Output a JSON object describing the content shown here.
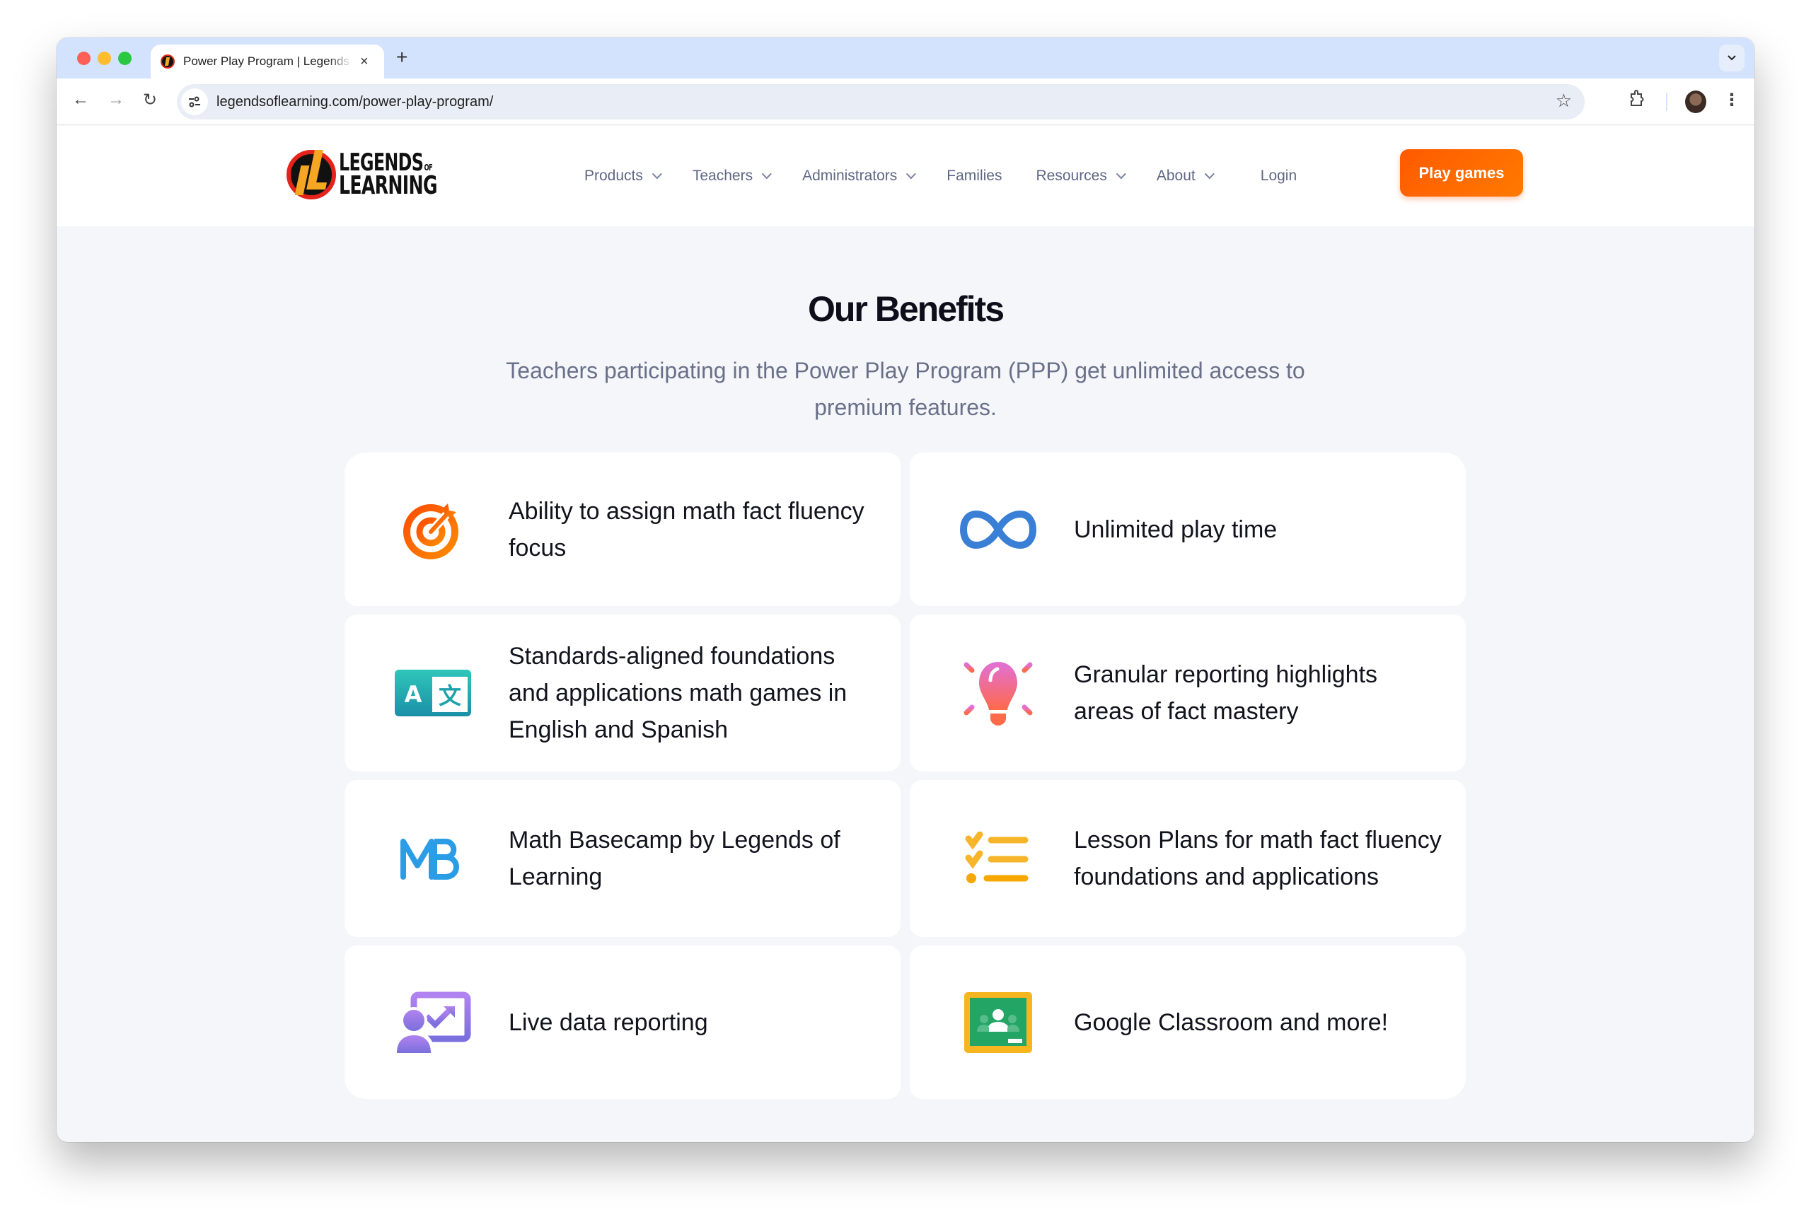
{
  "browser": {
    "tab_title": "Power Play Program | Legends of Learning",
    "url": "legendsoflearning.com/power-play-program/",
    "icons": {
      "close": "×",
      "new_tab": "+",
      "tab_menu": "⌄",
      "back": "←",
      "forward": "→",
      "reload": "↻",
      "site_info": "⚙",
      "bookmark": "☆",
      "extensions": "⧉",
      "menu": "⋮"
    }
  },
  "header": {
    "logo": {
      "line1": "LEGENDS",
      "of": "OF",
      "line2": "LEARNING"
    },
    "nav": [
      {
        "label": "Products",
        "dropdown": true
      },
      {
        "label": "Teachers",
        "dropdown": true
      },
      {
        "label": "Administrators",
        "dropdown": true
      },
      {
        "label": "Families",
        "dropdown": false
      },
      {
        "label": "Resources",
        "dropdown": true
      },
      {
        "label": "About",
        "dropdown": true
      }
    ],
    "login_label": "Login",
    "cta_label": "Play games",
    "cta_color": "#ff6a00"
  },
  "benefits": {
    "title": "Our Benefits",
    "subtitle": "Teachers participating in the Power Play Program (PPP) get unlimited access to premium features.",
    "items": [
      {
        "icon": "target-icon",
        "text": "Ability to assign math fact fluency focus"
      },
      {
        "icon": "infinity-icon",
        "text": "Unlimited play time"
      },
      {
        "icon": "translate-icon",
        "text": "Standards-aligned foundations and applications math games in English and Spanish"
      },
      {
        "icon": "lightbulb-icon",
        "text": "Granular reporting highlights areas of fact mastery"
      },
      {
        "icon": "math-basecamp-logo-icon",
        "text": "Math Basecamp by Legends of Learning",
        "icon_text": "MB"
      },
      {
        "icon": "checklist-icon",
        "text": "Lesson Plans for math fact fluency foundations and applications"
      },
      {
        "icon": "presentation-chart-icon",
        "text": "Live data reporting"
      },
      {
        "icon": "google-classroom-icon",
        "text": "Google Classroom and more!"
      }
    ]
  }
}
